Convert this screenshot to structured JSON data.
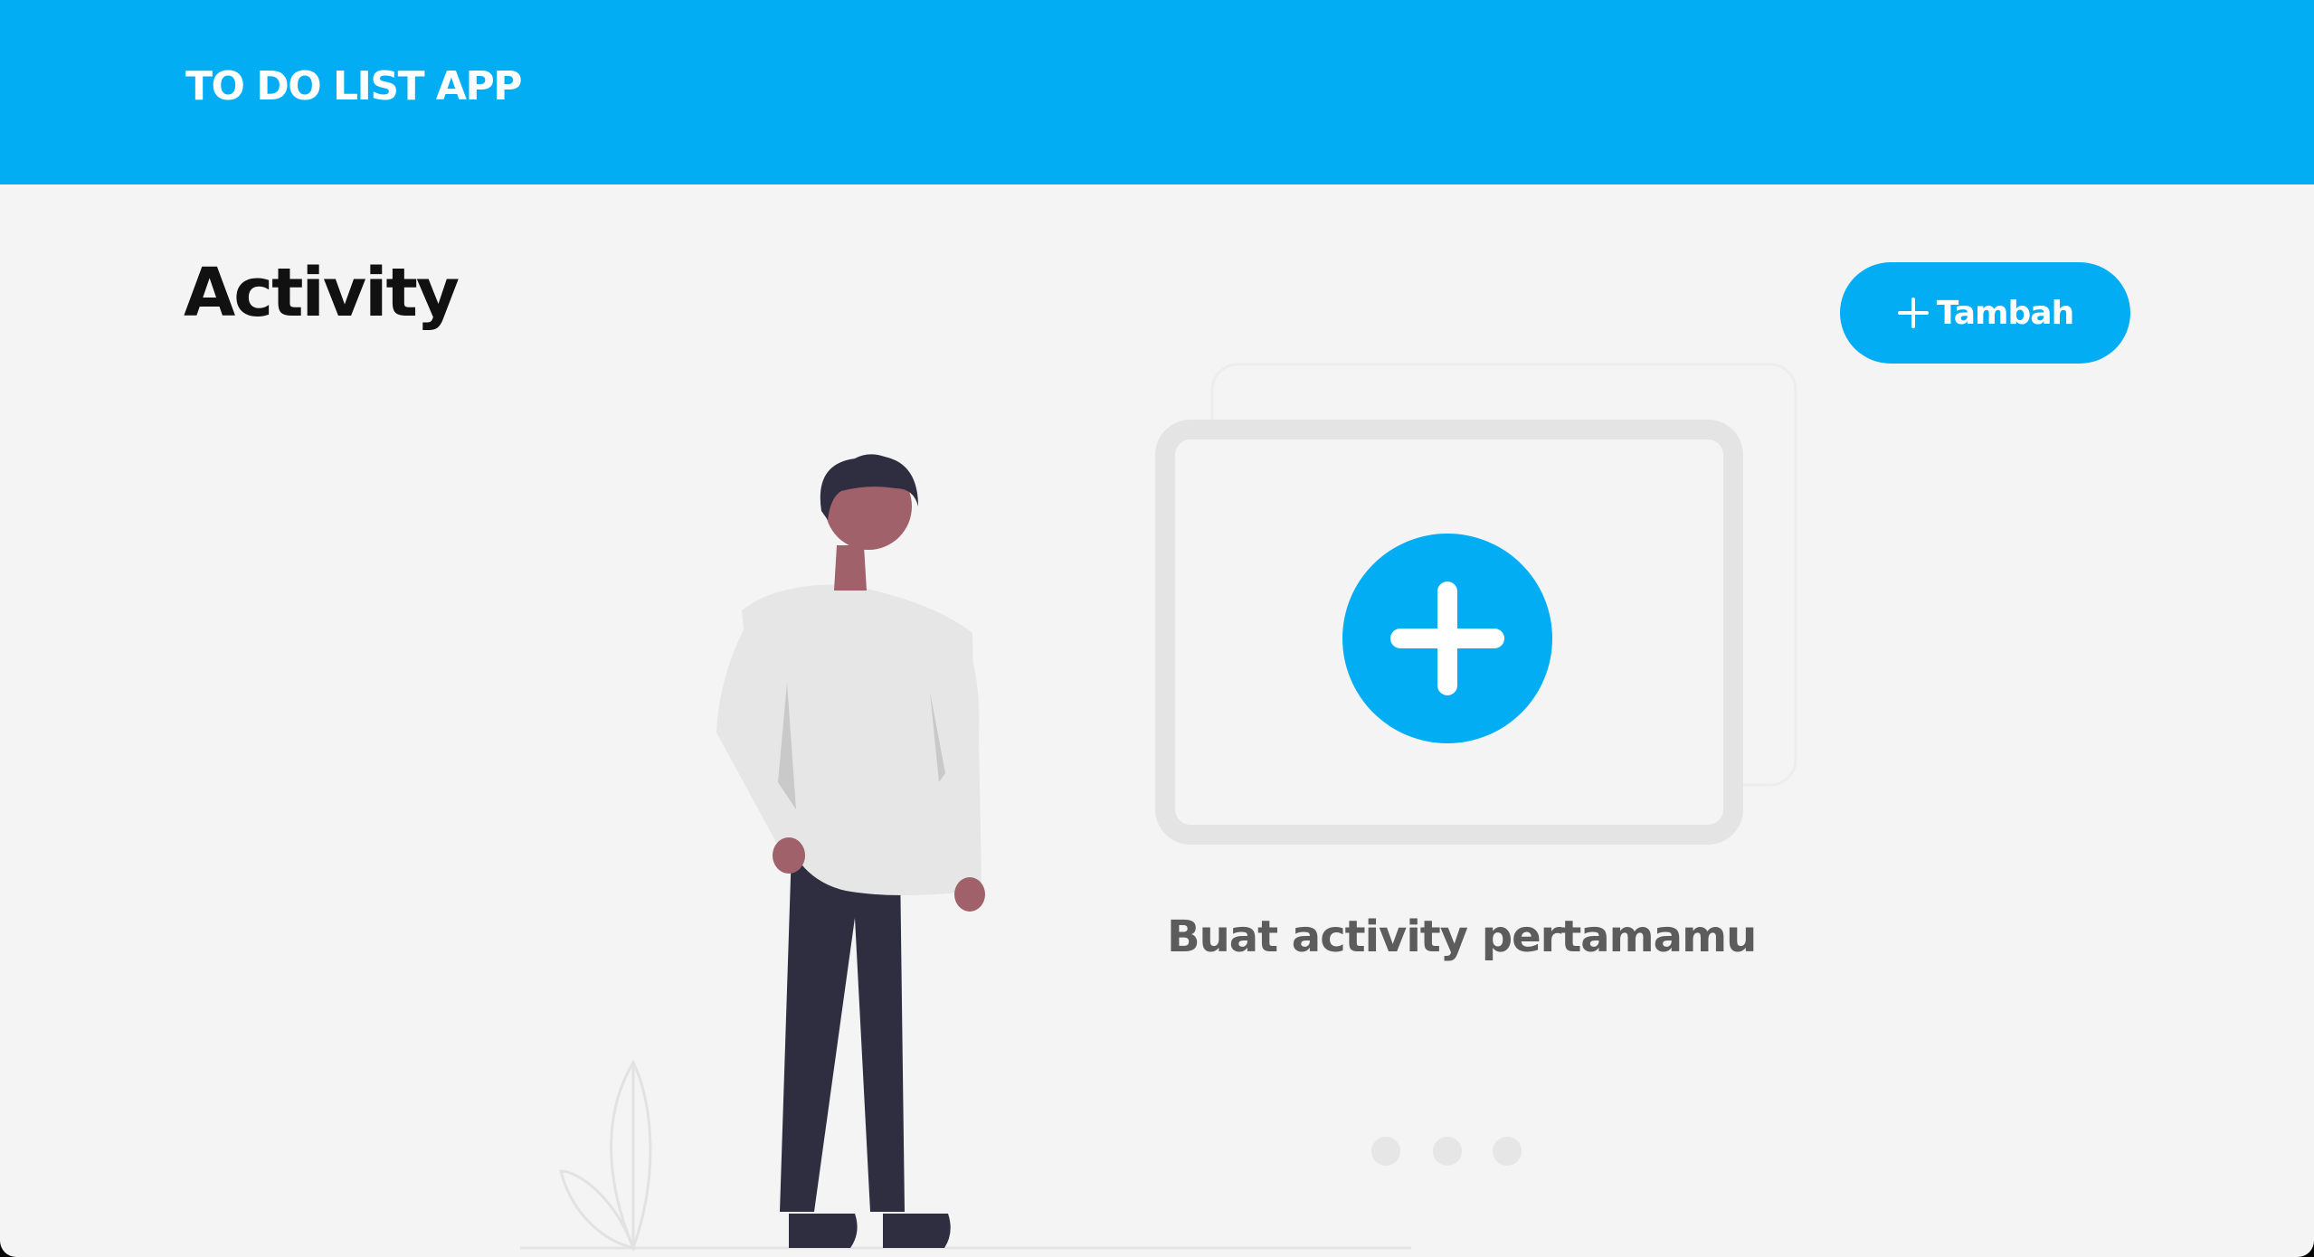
{
  "app": {
    "title": "TO DO LIST APP"
  },
  "page": {
    "title": "Activity"
  },
  "toolbar": {
    "add_label": "Tambah"
  },
  "empty_state": {
    "message": "Buat activity pertamamu"
  },
  "icons": {
    "add": "plus-icon",
    "empty_add": "plus-circle-icon"
  },
  "colors": {
    "primary": "#02ADF4",
    "background": "#F4F4F4",
    "title": "#111111",
    "muted_text": "#5C5C5C",
    "pants": "#2F2E41",
    "skin": "#A0616A"
  }
}
